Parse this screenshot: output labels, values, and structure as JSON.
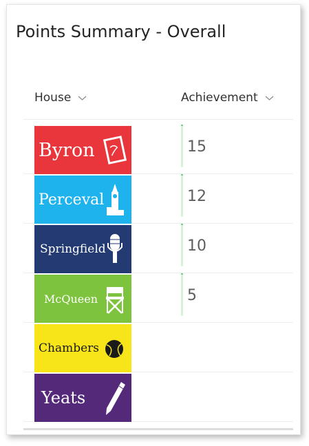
{
  "title": "Points Summary - Overall",
  "columns": {
    "house": "House",
    "achievement": "Achievement"
  },
  "rows": [
    {
      "house": "Byron",
      "achievement": "15",
      "color": "#e8363c",
      "icon": "book-icon"
    },
    {
      "house": "Perceval",
      "achievement": "12",
      "color": "#1fb3ee",
      "icon": "big-ben-icon"
    },
    {
      "house": "Springfield",
      "achievement": "10",
      "color": "#243a73",
      "icon": "microphone-icon"
    },
    {
      "house": "McQueen",
      "achievement": "5",
      "color": "#7dc33d",
      "icon": "directors-chair-icon"
    },
    {
      "house": "Chambers",
      "achievement": "",
      "color": "#f7e51a",
      "icon": "tennis-ball-icon"
    },
    {
      "house": "Yeats",
      "achievement": "",
      "color": "#55297a",
      "icon": "pen-icon"
    }
  ],
  "colors": {
    "bar_fill": "#d8efd8",
    "bar_cap": "#7ccf7c",
    "text": "#323130"
  }
}
